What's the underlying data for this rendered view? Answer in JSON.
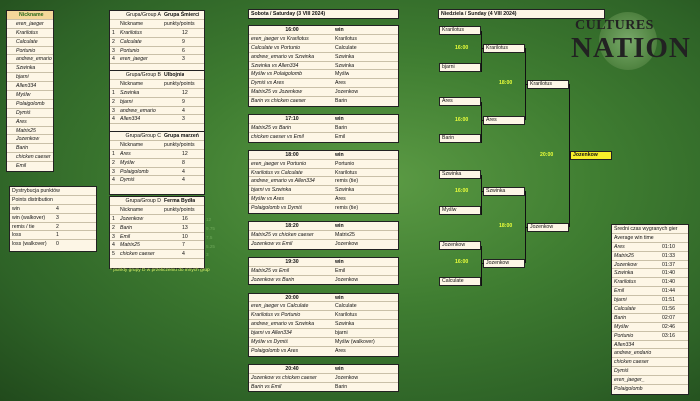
{
  "nickname_list": {
    "header": "Nickname",
    "items": [
      "eren_jaeger",
      "Krarilotus",
      "Calculate",
      "Portunio",
      "andrew_emario",
      "Szwinka",
      "bjarni",
      "Allen334",
      "Myślw",
      "Polaigolomb",
      "Dymiś",
      "Ares",
      "Matrix25",
      "Jozenkow",
      "Barin",
      "chicken caeser",
      "Emil"
    ]
  },
  "points": {
    "title_pl": "Dystrybucja punktów",
    "title_en": "Points distribution",
    "rows": [
      {
        "label": "win",
        "value": "4"
      },
      {
        "label": "win (walkover)",
        "value": "3"
      },
      {
        "label": "remis / tie",
        "value": "2"
      },
      {
        "label": "loss",
        "value": "1"
      },
      {
        "label": "loss (walkover)",
        "value": "0"
      }
    ]
  },
  "groups": [
    {
      "label": "Grupa/Group A",
      "name": "Grupa Śmierci",
      "col1": "Nickname",
      "col2": "punkty/points",
      "rows": [
        {
          "n": "1",
          "name": "Krarilotus",
          "pts": "12"
        },
        {
          "n": "2",
          "name": "Calculate",
          "pts": "9"
        },
        {
          "n": "3",
          "name": "Portunio",
          "pts": "6"
        },
        {
          "n": "4",
          "name": "eren_jaeger",
          "pts": "3"
        }
      ]
    },
    {
      "label": "Grupa/Group B",
      "name": "Ulbojnia",
      "col1": "Nickname",
      "col2": "punkty/points",
      "rows": [
        {
          "n": "1",
          "name": "Szwinka",
          "pts": "12"
        },
        {
          "n": "2",
          "name": "bjarni",
          "pts": "9"
        },
        {
          "n": "3",
          "name": "andrew_emario",
          "pts": "4"
        },
        {
          "n": "4",
          "name": "Allen334",
          "pts": "3"
        }
      ]
    },
    {
      "label": "Grupa/Group C",
      "name": "Grupa marzeń",
      "col1": "Nickname",
      "col2": "punkty/points",
      "rows": [
        {
          "n": "1",
          "name": "Ares",
          "pts": "12"
        },
        {
          "n": "2",
          "name": "Myślw",
          "pts": "8"
        },
        {
          "n": "3",
          "name": "Polaigolomb",
          "pts": "4"
        },
        {
          "n": "4",
          "name": "Dymiś",
          "pts": "4"
        }
      ]
    },
    {
      "label": "Grupa/Group D",
      "name": "Ferma Bydła",
      "col1": "Nickname",
      "col2": "punkty/points",
      "rows": [
        {
          "n": "1",
          "name": "Jozenkow",
          "pts": "16",
          "adj": "12"
        },
        {
          "n": "2",
          "name": "Barin",
          "pts": "13",
          "adj": "9.75"
        },
        {
          "n": "3",
          "name": "Emil",
          "pts": "10",
          "adj": "7.5"
        },
        {
          "n": "4",
          "name": "Matrix25",
          "pts": "7",
          "adj": "5.25"
        },
        {
          "n": "5",
          "name": "chicken caeser",
          "pts": "4",
          "adj": "3"
        }
      ]
    }
  ],
  "group_note": "* punkty grupy D w przeliczeniu do innych grup",
  "saturday": {
    "header": "Sobota / Saturday (3 VIII 2024)",
    "win_label": "win",
    "slots": [
      {
        "time": "16:00",
        "matches": [
          {
            "m": "eren_jaeger vs Krarilotus",
            "w": "Krarilotus"
          },
          {
            "m": "Calculate vs Portunio",
            "w": "Calculate"
          },
          {
            "m": "andrew_emario vs Szwinka",
            "w": "Szwinka"
          },
          {
            "m": "Szwinka vs Allen334",
            "w": "Szwinka"
          },
          {
            "m": "Myślw vs Polaigolomb",
            "w": "Myślw"
          },
          {
            "m": "Dymiś vs Ares",
            "w": "Ares"
          },
          {
            "m": "Matrix25 vs Jozenkow",
            "w": "Jozenkow"
          },
          {
            "m": "Barin vs chicken caeser",
            "w": "Barin"
          }
        ]
      },
      {
        "time": "17:10",
        "matches": [
          {
            "m": "Matrix25 vs Barin",
            "w": "Barin"
          },
          {
            "m": "chicken caeser vs Emil",
            "w": "Emil"
          }
        ]
      },
      {
        "time": "18:00",
        "matches": [
          {
            "m": "eren_jaeger vs Portunio",
            "w": "Portunio"
          },
          {
            "m": "Krarilotus vs Calculate",
            "w": "Krarilotus"
          },
          {
            "m": "andrew_emario vs Allen334",
            "w": "remis (tie)"
          },
          {
            "m": "bjarni vs Szwinka",
            "w": "Szwinka"
          },
          {
            "m": "Myślw vs Ares",
            "w": "Ares"
          },
          {
            "m": "Polaigolomb vs Dymiś",
            "w": "remis (tie)"
          }
        ]
      },
      {
        "time": "18:20",
        "matches": [
          {
            "m": "Matrix25 vs chicken caeser",
            "w": "Matrix25"
          },
          {
            "m": "Jozenkow vs Emil",
            "w": "Jozenkow"
          }
        ]
      },
      {
        "time": "19:30",
        "matches": [
          {
            "m": "Matrix25 vs Emil",
            "w": "Emil"
          },
          {
            "m": "Jozenkow vs Barin",
            "w": "Jozenkow"
          }
        ]
      },
      {
        "time": "20:00",
        "matches": [
          {
            "m": "eren_jaeger vs Calculate",
            "w": "Calculate"
          },
          {
            "m": "Krarilotus vs Portunio",
            "w": "Krarilotus"
          },
          {
            "m": "andrew_emario vs Szwinka",
            "w": "Szwinka"
          },
          {
            "m": "bjarni vs Allen334",
            "w": "bjarni"
          },
          {
            "m": "Myślw vs Dymiś",
            "w": "Myślw (walkover)"
          },
          {
            "m": "Polaigolomb vs Ares",
            "w": "Ares"
          }
        ]
      },
      {
        "time": "20:40",
        "matches": [
          {
            "m": "Jozenkow vs chicken caeser",
            "w": "Jozenkow"
          },
          {
            "m": "Barin vs Emil",
            "w": "Barin"
          }
        ]
      }
    ]
  },
  "sunday": {
    "header": "Niedziela / Sunday (4 VIII 2024)",
    "r1": [
      "Krarilotus",
      "bjarni",
      "Ares",
      "Barin",
      "Szwinka",
      "Myślw",
      "Jozenkow",
      "Calculate"
    ],
    "r2": [
      "Krarilotus",
      "Ares",
      "Szwinka",
      "Jozenkow"
    ],
    "r3": [
      "Krarilotus",
      "Jozenkow"
    ],
    "champion": "Jozenkow",
    "times": {
      "r1a": "16:00",
      "r1b": "16:00",
      "r1c": "16:00",
      "r1d": "16:00",
      "r2a": "18:00",
      "r2b": "18:00",
      "final": "20:00"
    }
  },
  "logo": {
    "line1": "CULTURES",
    "line2": "NATION"
  },
  "win_times": {
    "title_pl": "Średni czas wygranych gier",
    "title_en": "Average win time",
    "rows": [
      {
        "n": "Ares",
        "t": "01:10"
      },
      {
        "n": "Matrix25",
        "t": "01:33"
      },
      {
        "n": "Jozenkow",
        "t": "01:37"
      },
      {
        "n": "Szwinka",
        "t": "01:40"
      },
      {
        "n": "Krarilotus",
        "t": "01:40"
      },
      {
        "n": "Emil",
        "t": "01:44"
      },
      {
        "n": "bjarni",
        "t": "01:51"
      },
      {
        "n": "Calculate",
        "t": "01:56"
      },
      {
        "n": "Barin",
        "t": "02:07"
      },
      {
        "n": "Myślw",
        "t": "02:46"
      },
      {
        "n": "Portunio",
        "t": "03:16"
      },
      {
        "n": "Allen334",
        "t": ""
      },
      {
        "n": "andrew_endario",
        "t": ""
      },
      {
        "n": "chicken caeser",
        "t": ""
      },
      {
        "n": "Dymiś",
        "t": ""
      },
      {
        "n": "eren_jaeger_",
        "t": ""
      },
      {
        "n": "Polaigolomb",
        "t": ""
      }
    ]
  },
  "colors": {
    "header": "#f4d79a",
    "winner": "#f7ef2a",
    "time": "#eaff3a",
    "background": "#3f7d31"
  }
}
